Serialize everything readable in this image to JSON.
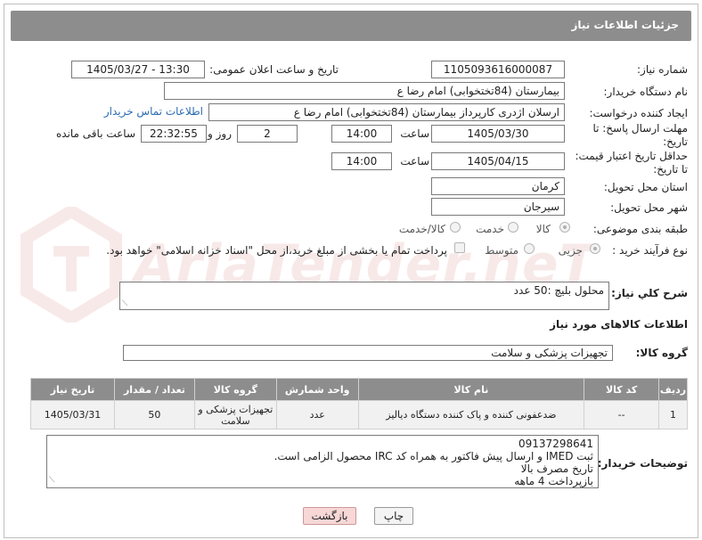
{
  "header": {
    "title": "جزئیات اطلاعات نیاز"
  },
  "fields": {
    "need_number_label": "شماره نیاز:",
    "need_number": "1105093616000087",
    "announce_label": "تاریخ و ساعت اعلان عمومی:",
    "announce_value": "1405/03/27 - 13:30",
    "buyer_org_label": "نام دستگاه خریدار:",
    "buyer_org": "بیمارستان (84تختخوابی) امام رضا  ع",
    "requester_label": "ایجاد کننده درخواست:",
    "requester": "ارسلان اژدری کارپرداز بیمارستان (84تختخوابی) امام رضا  ع",
    "contact_link": "اطلاعات تماس خریدار",
    "reply_deadline_label": "مهلت ارسال پاسخ: تا تاریخ:",
    "reply_date": "1405/03/30",
    "hour_label": "ساعت",
    "reply_time": "14:00",
    "days_value": "2",
    "days_label": "روز و",
    "remaining_value": "22:32:55",
    "remaining_label": "ساعت باقی مانده",
    "price_validity_label": "حداقل تاریخ اعتبار قیمت: تا تاریخ:",
    "price_date": "1405/04/15",
    "price_hour_label": "ساعت",
    "price_time": "14:00",
    "province_label": "استان محل تحویل:",
    "province": "کرمان",
    "city_label": "شهر محل تحویل:",
    "city": "سیرجان",
    "category_label": "طبقه بندی موضوعی:",
    "category_opts": [
      "کالا",
      "خدمت",
      "کالا/خدمت"
    ],
    "process_label": "نوع فرآیند خرید :",
    "process_opts": [
      "جزیی",
      "متوسط"
    ],
    "payment_note": "پرداخت تمام یا بخشی از مبلغ خرید،از محل \"اسناد خزانه اسلامی\" خواهد بود."
  },
  "summary": {
    "label": "شرح کلي نياز:",
    "text": "محلول بلیچ :50 عدد"
  },
  "items_section": {
    "title": "اطلاعات کالاهای مورد نیاز",
    "group_label": "گروه کالا:",
    "group_value": "تجهیزات پزشکی و سلامت"
  },
  "table": {
    "headers": [
      "ردیف",
      "کد کالا",
      "نام کالا",
      "واحد شمارش",
      "گروه کالا",
      "تعداد / مقدار",
      "تاریخ نیاز"
    ],
    "rows": [
      [
        "1",
        "--",
        "ضدعفونی کننده و پاک کننده دستگاه دیالیز",
        "عدد",
        "تجهیزات پزشکی و سلامت",
        "50",
        "1405/03/31"
      ]
    ]
  },
  "buyer_notes": {
    "label": "توضیحات خریدار:",
    "lines": [
      "09137298641",
      "ثبت IMED و ارسال پیش فاکتور به همراه کد IRC محصول الزامی است.",
      "تاریخ مصرف بالا",
      "بازپرداخت 4 ماهه"
    ]
  },
  "buttons": {
    "print": "چاپ",
    "back": "بازگشت"
  },
  "watermark": {
    "text": "AriaTender.neT"
  },
  "colors": {
    "header_bg": "#8d8d8d",
    "link": "#2b6bb0",
    "print_btn": "#f4f4f4",
    "back_btn": "#f8d7d7"
  }
}
